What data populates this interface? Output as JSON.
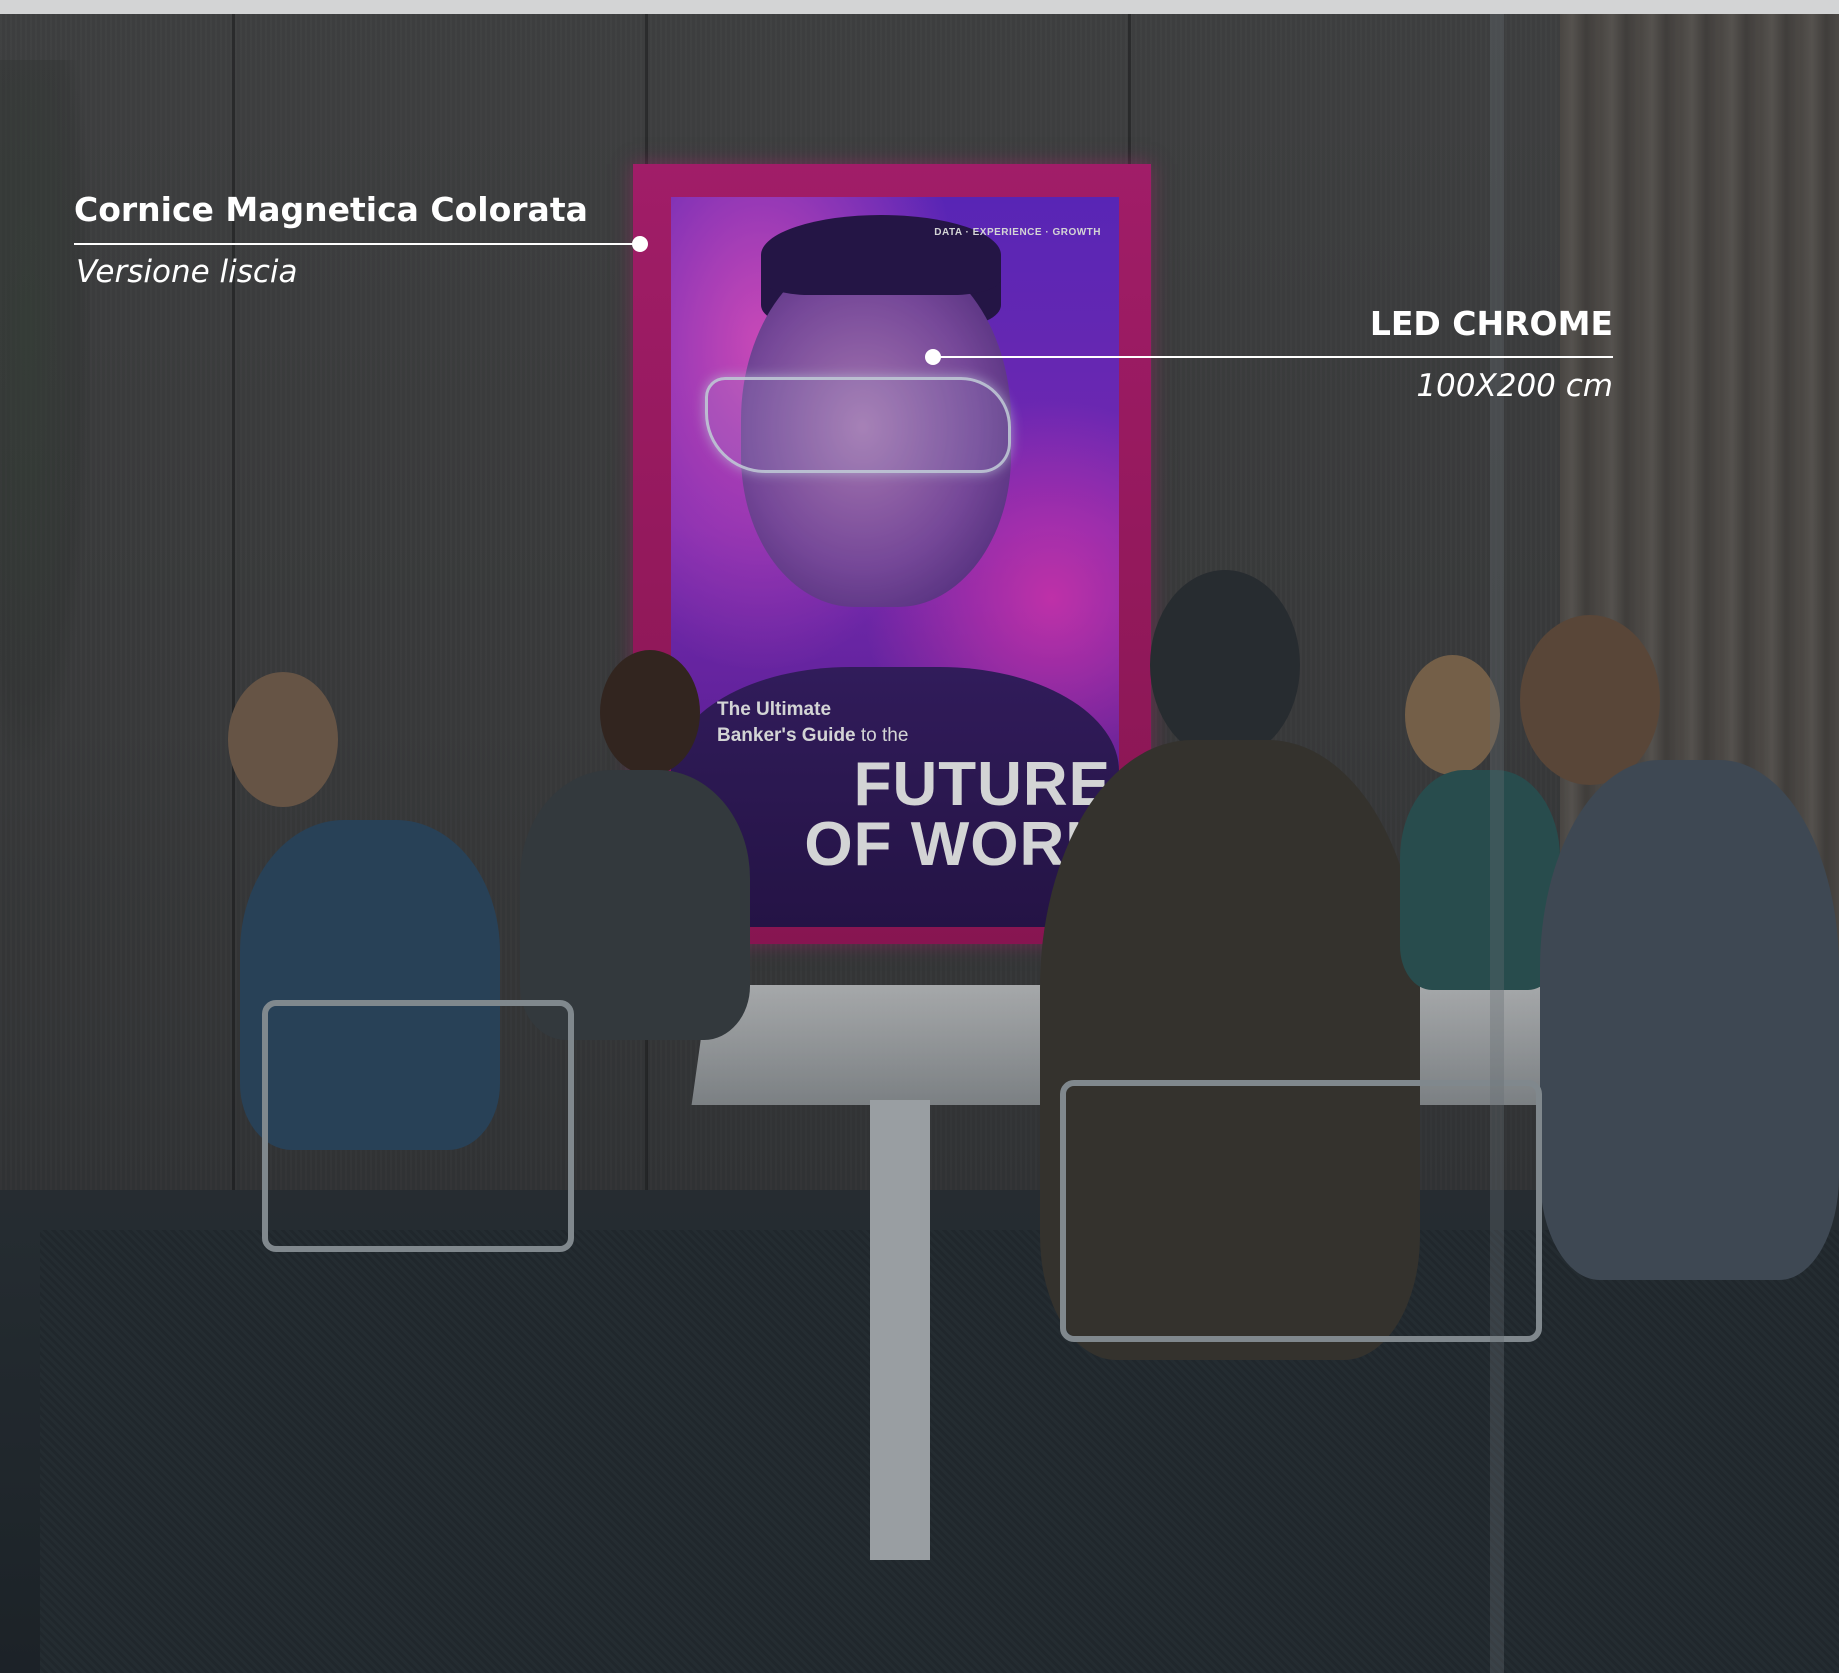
{
  "callouts": {
    "frame": {
      "title": "Cornice Magnetica Colorata",
      "subtitle": "Versione liscia"
    },
    "lightbox": {
      "title": "LED CHROME",
      "subtitle": "100X200 cm"
    }
  },
  "poster": {
    "topline": "DATA · EXPERIENCE · GROWTH",
    "line1": "The Ultimate",
    "line2_bold": "Banker's Guide",
    "line2_thin": " to the",
    "headline": "FUTURE\nOF WORK"
  },
  "colors": {
    "frame": "#c2207a",
    "poster_purple": "#6a2ad8",
    "annotation": "#ffffff"
  }
}
